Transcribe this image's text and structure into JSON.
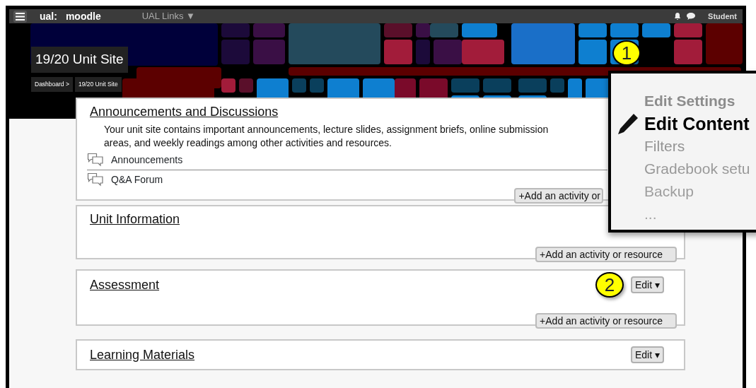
{
  "navbar": {
    "brand_prefix": "ual:",
    "brand": "moodle",
    "links_menu": "UAL Links ▼",
    "user": "Student"
  },
  "banner": {
    "title": "19/20 Unit Site",
    "breadcrumb": [
      "Dashboard >",
      "19/20 Unit Site"
    ]
  },
  "sections": [
    {
      "title": "Announcements and Discussions",
      "description": "Your unit site contains important announcements, lecture slides, assignment briefs, online submission areas, and weekly readings among other activities and resources.",
      "activities": [
        {
          "label": "Announcements",
          "kind": "forum"
        },
        {
          "label": "Q&A Forum",
          "kind": "forum"
        }
      ],
      "add_button": "+Add an activity or"
    },
    {
      "title": "Unit Information",
      "add_button": "+Add an activity or resource"
    },
    {
      "title": "Assessment",
      "callout": "2",
      "edit_button": "Edit ▾",
      "add_button": "+Add an activity or resource"
    },
    {
      "title": "Learning Materials",
      "edit_button": "Edit ▾"
    }
  ],
  "edit_menu": {
    "callout": "1",
    "items": [
      {
        "label": "Edit Settings",
        "selected": false,
        "color": "#8c8c8c"
      },
      {
        "label": "Edit Content",
        "selected": true,
        "color": "#000000"
      },
      {
        "label": "Filters",
        "selected": false,
        "color": "#939393"
      },
      {
        "label": "Gradebook setu",
        "selected": false,
        "color": "#999999"
      },
      {
        "label": "Backup",
        "selected": false,
        "color": "#9e9e9e"
      },
      {
        "label": "...",
        "selected": false,
        "color": "#a3a3a3"
      }
    ]
  }
}
